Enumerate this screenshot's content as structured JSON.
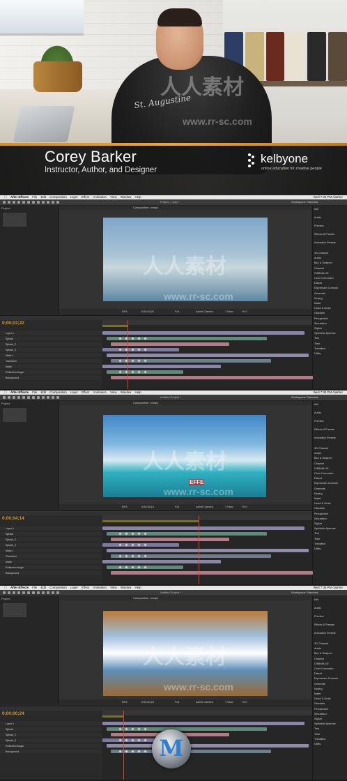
{
  "presenter": {
    "name": "Corey Barker",
    "title": "Instructor, Author, and Designer",
    "brand_name": "kelbyone",
    "brand_tagline": "online education for creative people",
    "shirt_text": "St. Augustine"
  },
  "watermark": {
    "text_cn": "人人素材",
    "text_url": "www.rr-sc.com",
    "badge": "M"
  },
  "ae_panels": [
    {
      "menu": [
        "After Effects",
        "File",
        "Edit",
        "Composition",
        "Layer",
        "Effect",
        "Animation",
        "View",
        "Window",
        "Help"
      ],
      "status_right": "Wed 7:34 PM   cbarker",
      "window_title": "Project_1.aep *",
      "workspace": "Workspace:  Standard",
      "viewer_tab": "Composition: comp1",
      "viewer_footer": [
        "50%",
        "0;00;03;22",
        "Full",
        "Active Camera",
        "1 View",
        "+0.0"
      ],
      "timecode": "0;00;03;22",
      "timecode_marker_fill": 0.12,
      "right_panel": [
        "Info",
        "Audio",
        "Preview",
        "Effects & Presets",
        "Animation Presets",
        "3D Channel",
        "Audio",
        "Blur & Sharpen",
        "Channel",
        "CINEMA 4D",
        "Color Correction",
        "Distort",
        "Expression Controls",
        "Generate",
        "Keying",
        "Matte",
        "Noise & Grain",
        "Obsolete",
        "Perspective",
        "Simulation",
        "Stylize",
        "Synthetic Aperture",
        "Text",
        "Time",
        "Transition",
        "Utility"
      ],
      "layers": [
        "Layer 1",
        "Splash",
        "Splash_2",
        "Splash_3",
        "Mask 1",
        "Transform",
        "Matte",
        "Reflection Angle",
        "Background"
      ]
    },
    {
      "menu": [
        "After Effects",
        "File",
        "Edit",
        "Composition",
        "Layer",
        "Effect",
        "Animation",
        "View",
        "Window",
        "Help"
      ],
      "status_right": "Wed 7:35 PM   cbarker",
      "window_title": "Untitled Project *",
      "workspace": "Workspace:  Standard",
      "viewer_tab": "Composition: comp1",
      "viewer_footer": [
        "50%",
        "0;00;04;14",
        "Full",
        "Active Camera",
        "1 View",
        "+0.0"
      ],
      "timecode": "0;00;04;14",
      "timecode_marker_fill": 0.46,
      "overlay_text": "EFFE",
      "right_panel": [
        "Info",
        "Audio",
        "Preview",
        "Effects & Presets",
        "Animation Presets",
        "3D Channel",
        "Audio",
        "Blur & Sharpen",
        "Channel",
        "CINEMA 4D",
        "Color Correction",
        "Distort",
        "Expression Controls",
        "Generate",
        "Keying",
        "Matte",
        "Noise & Grain",
        "Obsolete",
        "Perspective",
        "Simulation",
        "Stylize",
        "Synthetic Aperture",
        "Text",
        "Time",
        "Transition",
        "Utility"
      ],
      "layers": [
        "Layer 1",
        "Splash",
        "Splash_2",
        "Splash_3",
        "Mask 1",
        "Transform",
        "Matte",
        "Reflection Angle",
        "Background"
      ]
    },
    {
      "menu": [
        "After Effects",
        "File",
        "Edit",
        "Composition",
        "Layer",
        "Effect",
        "Animation",
        "View",
        "Window",
        "Help"
      ],
      "status_right": "Wed 7:36 PM   cbarker",
      "window_title": "Untitled Project *",
      "workspace": "Workspace:  Standard",
      "viewer_tab": "Composition: comp1",
      "viewer_footer": [
        "50%",
        "0;00;00;24",
        "Full",
        "Active Camera",
        "1 View",
        "+0.0"
      ],
      "timecode": "0;00;00;24",
      "timecode_marker_fill": 0.1,
      "right_panel": [
        "Info",
        "Audio",
        "Preview",
        "Effects & Presets",
        "Animation Presets",
        "3D Channel",
        "Audio",
        "Blur & Sharpen",
        "Channel",
        "CINEMA 4D",
        "Color Correction",
        "Distort",
        "Expression Controls",
        "Generate",
        "Keying",
        "Matte",
        "Noise & Grain",
        "Obsolete",
        "Perspective",
        "Simulation",
        "Stylize",
        "Synthetic Aperture",
        "Text",
        "Time",
        "Transition",
        "Utility"
      ],
      "layers": [
        "Layer 1",
        "Splash",
        "Splash_2",
        "Splash_3",
        "Reflection Angle",
        "Background"
      ]
    }
  ],
  "colors": {
    "accent_orange": "#e8a030",
    "timecode": "#d99a2b",
    "cti_red": "#e2402f",
    "track_purple": "#8a86a8",
    "track_teal": "#5f8a7c",
    "track_pink": "#b07a86"
  }
}
